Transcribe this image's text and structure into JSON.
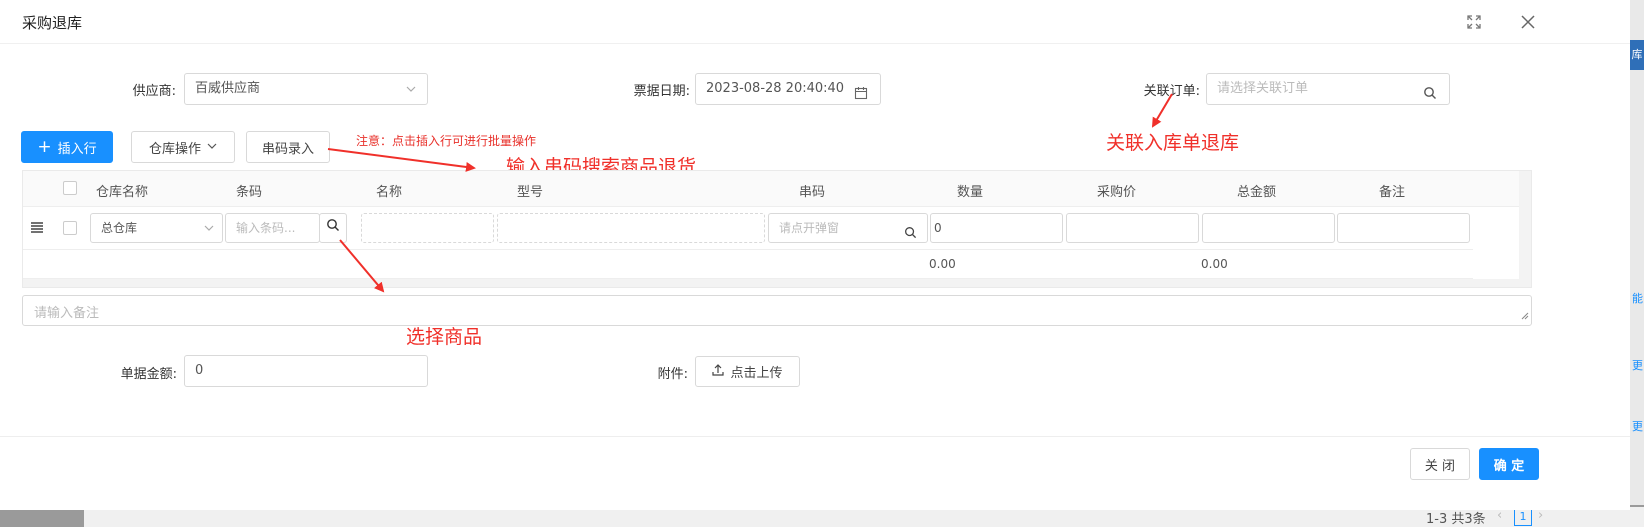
{
  "dialog": {
    "title": "采购退库",
    "fullscreen_icon": "expand-icon",
    "close_icon": "close-icon"
  },
  "form": {
    "supplier": {
      "label": "供应商:",
      "value": "百威供应商"
    },
    "bill_date": {
      "label": "票据日期:",
      "value": "2023-08-28 20:40:40"
    },
    "linked_order": {
      "label": "关联订单:",
      "placeholder": "请选择关联订单"
    },
    "bill_amount": {
      "label": "单据金额:",
      "value": "0"
    },
    "attachment": {
      "label": "附件:",
      "button": "点击上传"
    },
    "remark_placeholder": "请输入备注"
  },
  "toolbar": {
    "insert_row": "插入行",
    "warehouse_ops": "仓库操作",
    "serial_entry": "串码录入",
    "note": "注意：点击插入行可进行批量操作"
  },
  "table": {
    "columns": [
      "仓库名称",
      "条码",
      "名称",
      "型号",
      "串码",
      "数量",
      "采购价",
      "总金额",
      "备注"
    ],
    "row": {
      "warehouse": "总仓库",
      "barcode_placeholder": "输入条码...",
      "serial_placeholder": "请点开弹窗",
      "quantity": "0"
    },
    "summary": {
      "quantity_total": "0.00",
      "amount_total": "0.00"
    }
  },
  "annotations": {
    "serial_search": "输入串码搜索商品退货",
    "linked_return": "关联入库单退库",
    "select_product": "选择商品"
  },
  "footer": {
    "close": "关 闭",
    "confirm": "确 定"
  },
  "background": {
    "pager": "1-3 共3条",
    "page_number": "1",
    "side_texts": [
      "库",
      "能",
      "更",
      "更"
    ]
  },
  "colors": {
    "primary": "#1890ff",
    "annotation": "#f0302a"
  }
}
